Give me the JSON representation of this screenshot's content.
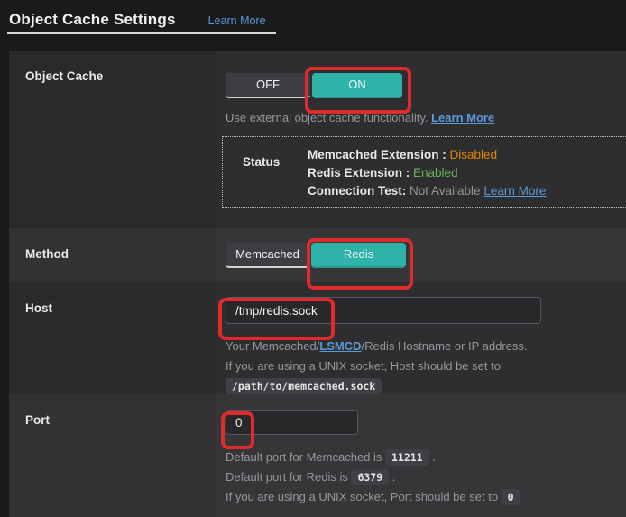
{
  "colors": {
    "accent_teal": "#2fb3a9",
    "annotation_red": "#df2b2b",
    "link_blue": "#5b9bd8",
    "status_disabled_orange": "#dd8500",
    "status_enabled_green": "#6cb45f"
  },
  "header": {
    "title": "Object Cache Settings",
    "learn_more_label": "Learn More"
  },
  "object_cache": {
    "label": "Object Cache",
    "off_label": "OFF",
    "on_label": "ON",
    "active": "ON",
    "description": "Use external object cache functionality. ",
    "description_link": "Learn More",
    "status": {
      "label": "Status",
      "memcached_name": "Memcached Extension : ",
      "memcached_value": "Disabled",
      "redis_name": "Redis Extension : ",
      "redis_value": "Enabled",
      "connection_name": "Connection Test: ",
      "connection_value": "Not Available ",
      "connection_link": "Learn More"
    }
  },
  "method": {
    "label": "Method",
    "memcached_label": "Memcached",
    "redis_label": "Redis",
    "active": "Redis"
  },
  "host": {
    "label": "Host",
    "value": "/tmp/redis.sock",
    "desc1_pre": "Your Memcached/",
    "desc1_link": "LSMCD",
    "desc1_post": "/Redis Hostname or IP address.",
    "desc2_text": "If you are using a UNIX socket, Host should be set to ",
    "desc2_code": "/path/to/memcached.sock"
  },
  "port": {
    "label": "Port",
    "value": "0",
    "lines": [
      {
        "pre": "Default port for Memcached is ",
        "code": "11211",
        "post": " ."
      },
      {
        "pre": "Default port for Redis is ",
        "code": "6379",
        "post": " ."
      },
      {
        "pre": "If you are using a UNIX socket, Port should be set to ",
        "code": "0",
        "post": ""
      }
    ]
  }
}
